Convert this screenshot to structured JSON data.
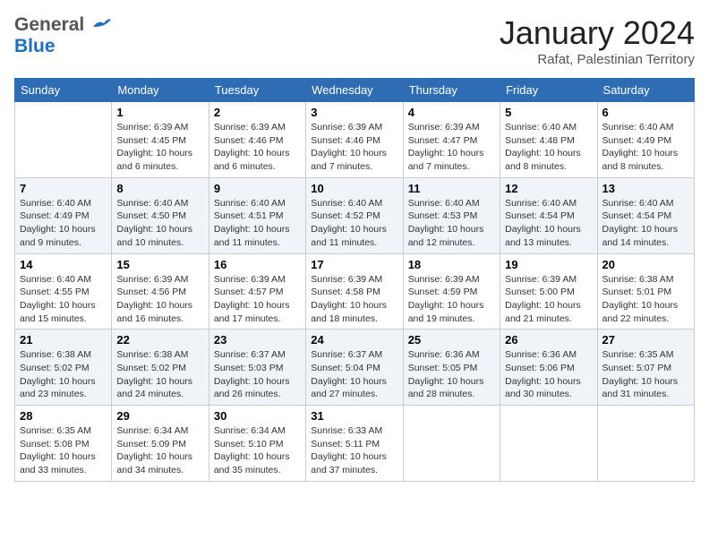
{
  "logo": {
    "line1": "General",
    "line2": "Blue"
  },
  "header": {
    "month": "January 2024",
    "location": "Rafat, Palestinian Territory"
  },
  "days_of_week": [
    "Sunday",
    "Monday",
    "Tuesday",
    "Wednesday",
    "Thursday",
    "Friday",
    "Saturday"
  ],
  "weeks": [
    [
      {
        "num": "",
        "info": ""
      },
      {
        "num": "1",
        "info": "Sunrise: 6:39 AM\nSunset: 4:45 PM\nDaylight: 10 hours\nand 6 minutes."
      },
      {
        "num": "2",
        "info": "Sunrise: 6:39 AM\nSunset: 4:46 PM\nDaylight: 10 hours\nand 6 minutes."
      },
      {
        "num": "3",
        "info": "Sunrise: 6:39 AM\nSunset: 4:46 PM\nDaylight: 10 hours\nand 7 minutes."
      },
      {
        "num": "4",
        "info": "Sunrise: 6:39 AM\nSunset: 4:47 PM\nDaylight: 10 hours\nand 7 minutes."
      },
      {
        "num": "5",
        "info": "Sunrise: 6:40 AM\nSunset: 4:48 PM\nDaylight: 10 hours\nand 8 minutes."
      },
      {
        "num": "6",
        "info": "Sunrise: 6:40 AM\nSunset: 4:49 PM\nDaylight: 10 hours\nand 8 minutes."
      }
    ],
    [
      {
        "num": "7",
        "info": "Sunrise: 6:40 AM\nSunset: 4:49 PM\nDaylight: 10 hours\nand 9 minutes."
      },
      {
        "num": "8",
        "info": "Sunrise: 6:40 AM\nSunset: 4:50 PM\nDaylight: 10 hours\nand 10 minutes."
      },
      {
        "num": "9",
        "info": "Sunrise: 6:40 AM\nSunset: 4:51 PM\nDaylight: 10 hours\nand 11 minutes."
      },
      {
        "num": "10",
        "info": "Sunrise: 6:40 AM\nSunset: 4:52 PM\nDaylight: 10 hours\nand 11 minutes."
      },
      {
        "num": "11",
        "info": "Sunrise: 6:40 AM\nSunset: 4:53 PM\nDaylight: 10 hours\nand 12 minutes."
      },
      {
        "num": "12",
        "info": "Sunrise: 6:40 AM\nSunset: 4:54 PM\nDaylight: 10 hours\nand 13 minutes."
      },
      {
        "num": "13",
        "info": "Sunrise: 6:40 AM\nSunset: 4:54 PM\nDaylight: 10 hours\nand 14 minutes."
      }
    ],
    [
      {
        "num": "14",
        "info": "Sunrise: 6:40 AM\nSunset: 4:55 PM\nDaylight: 10 hours\nand 15 minutes."
      },
      {
        "num": "15",
        "info": "Sunrise: 6:39 AM\nSunset: 4:56 PM\nDaylight: 10 hours\nand 16 minutes."
      },
      {
        "num": "16",
        "info": "Sunrise: 6:39 AM\nSunset: 4:57 PM\nDaylight: 10 hours\nand 17 minutes."
      },
      {
        "num": "17",
        "info": "Sunrise: 6:39 AM\nSunset: 4:58 PM\nDaylight: 10 hours\nand 18 minutes."
      },
      {
        "num": "18",
        "info": "Sunrise: 6:39 AM\nSunset: 4:59 PM\nDaylight: 10 hours\nand 19 minutes."
      },
      {
        "num": "19",
        "info": "Sunrise: 6:39 AM\nSunset: 5:00 PM\nDaylight: 10 hours\nand 21 minutes."
      },
      {
        "num": "20",
        "info": "Sunrise: 6:38 AM\nSunset: 5:01 PM\nDaylight: 10 hours\nand 22 minutes."
      }
    ],
    [
      {
        "num": "21",
        "info": "Sunrise: 6:38 AM\nSunset: 5:02 PM\nDaylight: 10 hours\nand 23 minutes."
      },
      {
        "num": "22",
        "info": "Sunrise: 6:38 AM\nSunset: 5:02 PM\nDaylight: 10 hours\nand 24 minutes."
      },
      {
        "num": "23",
        "info": "Sunrise: 6:37 AM\nSunset: 5:03 PM\nDaylight: 10 hours\nand 26 minutes."
      },
      {
        "num": "24",
        "info": "Sunrise: 6:37 AM\nSunset: 5:04 PM\nDaylight: 10 hours\nand 27 minutes."
      },
      {
        "num": "25",
        "info": "Sunrise: 6:36 AM\nSunset: 5:05 PM\nDaylight: 10 hours\nand 28 minutes."
      },
      {
        "num": "26",
        "info": "Sunrise: 6:36 AM\nSunset: 5:06 PM\nDaylight: 10 hours\nand 30 minutes."
      },
      {
        "num": "27",
        "info": "Sunrise: 6:35 AM\nSunset: 5:07 PM\nDaylight: 10 hours\nand 31 minutes."
      }
    ],
    [
      {
        "num": "28",
        "info": "Sunrise: 6:35 AM\nSunset: 5:08 PM\nDaylight: 10 hours\nand 33 minutes."
      },
      {
        "num": "29",
        "info": "Sunrise: 6:34 AM\nSunset: 5:09 PM\nDaylight: 10 hours\nand 34 minutes."
      },
      {
        "num": "30",
        "info": "Sunrise: 6:34 AM\nSunset: 5:10 PM\nDaylight: 10 hours\nand 35 minutes."
      },
      {
        "num": "31",
        "info": "Sunrise: 6:33 AM\nSunset: 5:11 PM\nDaylight: 10 hours\nand 37 minutes."
      },
      {
        "num": "",
        "info": ""
      },
      {
        "num": "",
        "info": ""
      },
      {
        "num": "",
        "info": ""
      }
    ]
  ]
}
